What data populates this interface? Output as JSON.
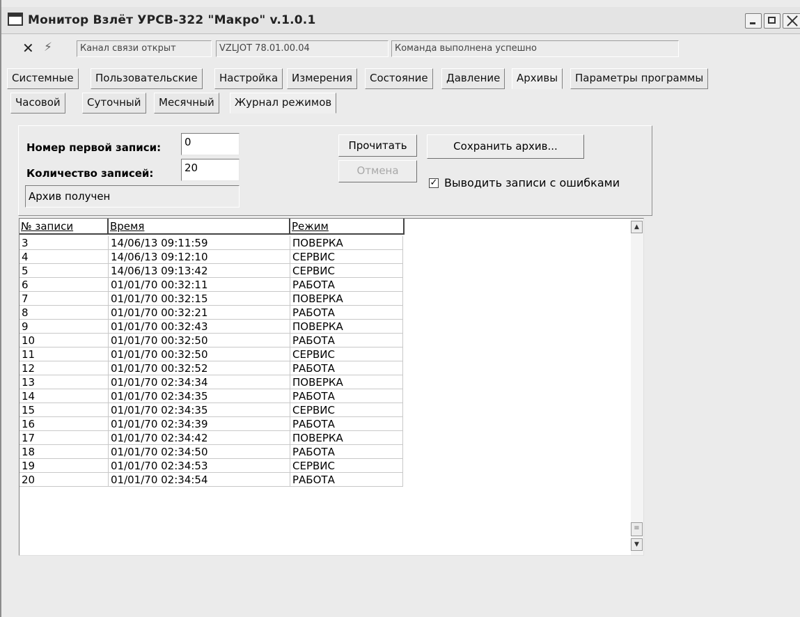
{
  "window": {
    "title": "Монитор Взлёт УРСВ-322 \"Макро\" v.1.0.1"
  },
  "statusbar": {
    "channel": "Канал связи открыт",
    "device": "VZLJOT 78.01.00.04",
    "command": "Команда выполнена успешно"
  },
  "main_tabs": [
    {
      "label": "Системные"
    },
    {
      "label": "Пользовательские"
    },
    {
      "label": "Настройка"
    },
    {
      "label": "Измерения"
    },
    {
      "label": "Состояние"
    },
    {
      "label": "Давление"
    },
    {
      "label": "Архивы"
    },
    {
      "label": "Параметры программы"
    }
  ],
  "archive_tabs": [
    {
      "label": "Часовой"
    },
    {
      "label": "Суточный"
    },
    {
      "label": "Месячный"
    },
    {
      "label": "Журнал режимов"
    }
  ],
  "panel": {
    "first_record_label": "Номер первой записи:",
    "first_record_value": "0",
    "count_label": "Количество записей:",
    "count_value": "20",
    "status_message": "Архив получен",
    "read_button": "Прочитать",
    "cancel_button": "Отмена",
    "save_button": "Сохранить архив...",
    "show_errors_label": "Выводить записи с ошибками",
    "show_errors_checked": true
  },
  "table": {
    "columns": [
      "№ записи",
      "Время",
      "Режим"
    ],
    "rows": [
      [
        "3",
        "14/06/13 09:11:59",
        "ПОВЕРКА"
      ],
      [
        "4",
        "14/06/13 09:12:10",
        "СЕРВИС"
      ],
      [
        "5",
        "14/06/13 09:13:42",
        "СЕРВИС"
      ],
      [
        "6",
        "01/01/70 00:32:11",
        "РАБОТА"
      ],
      [
        "7",
        "01/01/70 00:32:15",
        "ПОВЕРКА"
      ],
      [
        "8",
        "01/01/70 00:32:21",
        "РАБОТА"
      ],
      [
        "9",
        "01/01/70 00:32:43",
        "ПОВЕРКА"
      ],
      [
        "10",
        "01/01/70 00:32:50",
        "РАБОТА"
      ],
      [
        "11",
        "01/01/70 00:32:50",
        "СЕРВИС"
      ],
      [
        "12",
        "01/01/70 00:32:52",
        "РАБОТА"
      ],
      [
        "13",
        "01/01/70 02:34:34",
        "ПОВЕРКА"
      ],
      [
        "14",
        "01/01/70 02:34:35",
        "РАБОТА"
      ],
      [
        "15",
        "01/01/70 02:34:35",
        "СЕРВИС"
      ],
      [
        "16",
        "01/01/70 02:34:39",
        "РАБОТА"
      ],
      [
        "17",
        "01/01/70 02:34:42",
        "ПОВЕРКА"
      ],
      [
        "18",
        "01/01/70 02:34:50",
        "РАБОТА"
      ],
      [
        "19",
        "01/01/70 02:34:53",
        "СЕРВИС"
      ],
      [
        "20",
        "01/01/70 02:34:54",
        "РАБОТА"
      ]
    ]
  },
  "icons": {
    "plug": "plug-icon",
    "signal": "signal-icon",
    "app": "app-icon"
  }
}
